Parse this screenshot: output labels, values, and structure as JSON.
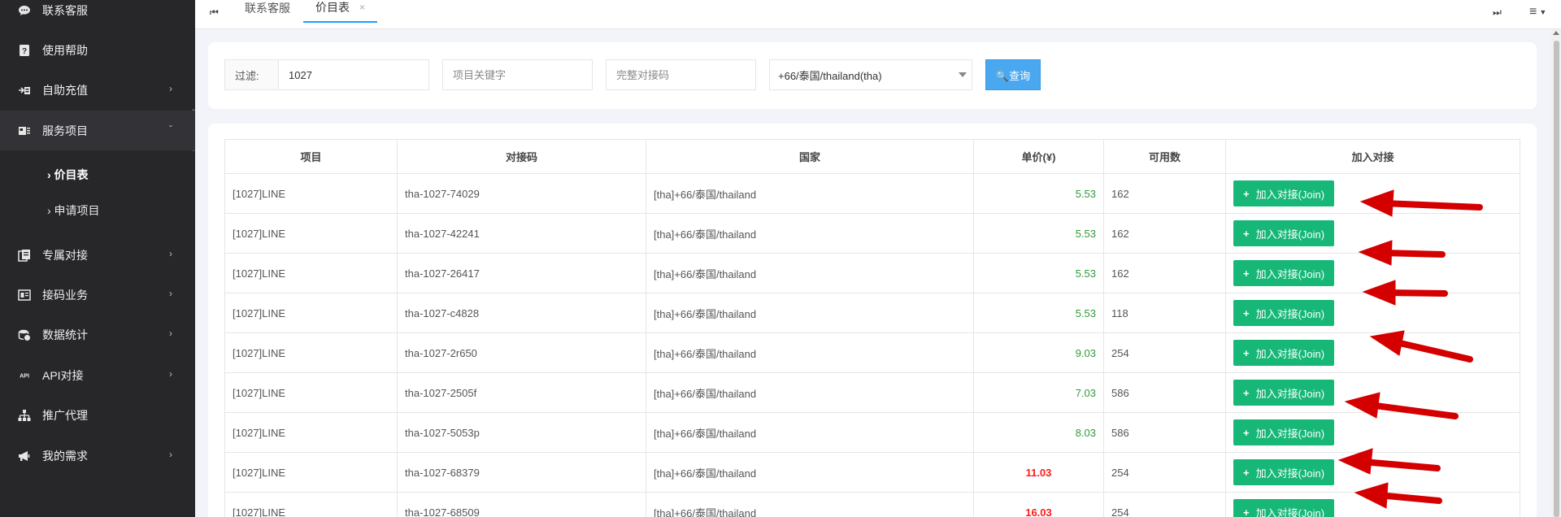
{
  "sidebar": {
    "items": [
      {
        "label": "联系客服",
        "icon": "chat-icon"
      },
      {
        "label": "使用帮助",
        "icon": "help-icon"
      },
      {
        "label": "自助充值",
        "icon": "recharge-icon"
      },
      {
        "label": "服务项目",
        "icon": "services-icon"
      },
      {
        "label": "专属对接",
        "icon": "exclusive-icon"
      },
      {
        "label": "接码业务",
        "icon": "sms-business-icon"
      },
      {
        "label": "数据统计",
        "icon": "statistics-icon"
      },
      {
        "label": "API对接",
        "icon": "api-icon"
      },
      {
        "label": "推广代理",
        "icon": "agent-icon"
      },
      {
        "label": "我的需求",
        "icon": "megaphone-icon"
      }
    ],
    "sub_items": [
      {
        "label": "› 价目表"
      },
      {
        "label": "› 申请项目"
      }
    ]
  },
  "tabs": {
    "first_icon": "⏮",
    "last_icon": "⏭",
    "menu_icon": "≡",
    "items": [
      {
        "label": "联系客服"
      },
      {
        "label": "价目表"
      }
    ],
    "close_glyph": "×"
  },
  "filter": {
    "label": "过滤:",
    "value": "1027",
    "keyword_placeholder": "项目关键字",
    "code_placeholder": "完整对接码",
    "country_selected": "+66/泰国/thailand(tha)",
    "query_label": "🔍查询"
  },
  "table": {
    "headers": [
      "项目",
      "对接码",
      "国家",
      "单价(¥)",
      "可用数",
      "加入对接"
    ],
    "join_label": "加入对接(Join)",
    "rows": [
      {
        "project": "[1027]LINE",
        "code": "tha-1027-74029",
        "country": "[tha]+66/泰国/thailand",
        "price": "5.53",
        "available": "162"
      },
      {
        "project": "[1027]LINE",
        "code": "tha-1027-42241",
        "country": "[tha]+66/泰国/thailand",
        "price": "5.53",
        "available": "162"
      },
      {
        "project": "[1027]LINE",
        "code": "tha-1027-26417",
        "country": "[tha]+66/泰国/thailand",
        "price": "5.53",
        "available": "162"
      },
      {
        "project": "[1027]LINE",
        "code": "tha-1027-c4828",
        "country": "[tha]+66/泰国/thailand",
        "price": "5.53",
        "available": "118"
      },
      {
        "project": "[1027]LINE",
        "code": "tha-1027-2r650",
        "country": "[tha]+66/泰国/thailand",
        "price": "9.03",
        "available": "254"
      },
      {
        "project": "[1027]LINE",
        "code": "tha-1027-2505f",
        "country": "[tha]+66/泰国/thailand",
        "price": "7.03",
        "available": "586"
      },
      {
        "project": "[1027]LINE",
        "code": "tha-1027-5053p",
        "country": "[tha]+66/泰国/thailand",
        "price": "8.03",
        "available": "586"
      },
      {
        "project": "[1027]LINE",
        "code": "tha-1027-68379",
        "country": "[tha]+66/泰国/thailand",
        "price": "11.03",
        "available": "254"
      },
      {
        "project": "[1027]LINE",
        "code": "tha-1027-68509",
        "country": "[tha]+66/泰国/thailand",
        "price": "16.03",
        "available": "254"
      }
    ]
  },
  "colors": {
    "sidebar_bg": "#27272a",
    "accent_blue": "#1e9fff",
    "join_green": "#16b777",
    "price_green": "#2f9b3a",
    "price_red": "#ff1a1a",
    "annotation_arrow": "#d40000"
  }
}
